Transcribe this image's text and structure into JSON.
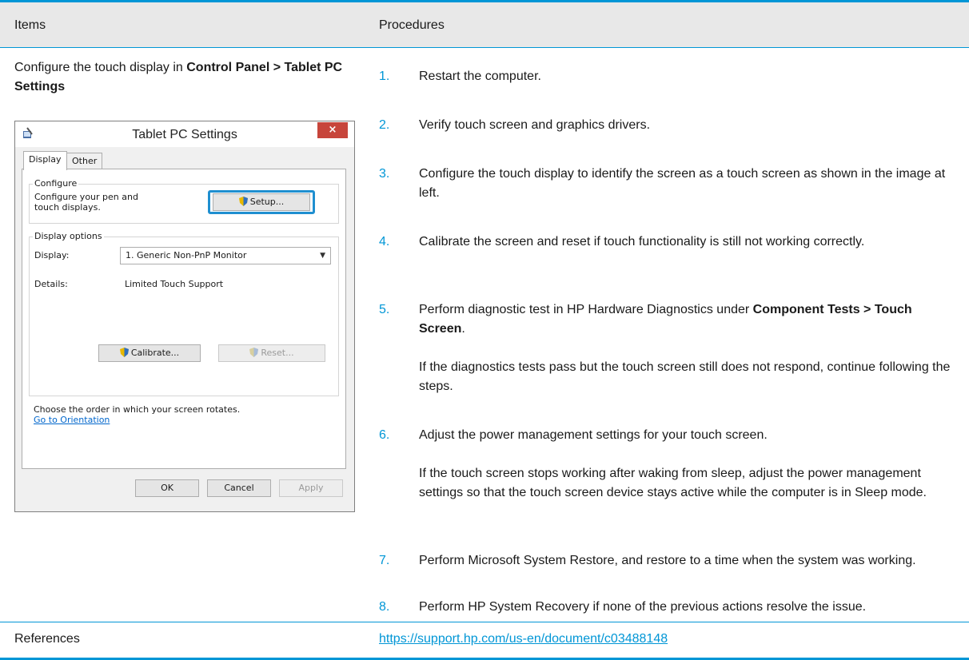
{
  "table": {
    "header_items": "Items",
    "header_procedures": "Procedures",
    "items_text_prefix": "Configure the touch display in ",
    "items_text_bold": "Control Panel > Tablet PC Settings",
    "references_label": "References",
    "references_link": "https://support.hp.com/us-en/document/c03488148"
  },
  "dialog": {
    "title": "Tablet PC Settings",
    "close_glyph": "×",
    "tabs": [
      "Display",
      "Other"
    ],
    "configure_group": "Configure",
    "configure_text": "Configure your pen and touch displays.",
    "setup_button": "Setup...",
    "display_options_group": "Display options",
    "display_label": "Display:",
    "display_value": "1. Generic Non-PnP Monitor",
    "details_label": "Details:",
    "details_value": "Limited Touch Support",
    "calibrate_button": "Calibrate...",
    "reset_button": "Reset...",
    "orientation_text": "Choose the order in which your screen rotates.",
    "orientation_link": "Go to Orientation",
    "ok_button": "OK",
    "cancel_button": "Cancel",
    "apply_button": "Apply"
  },
  "procedures": {
    "s1": {
      "num": "1.",
      "text": "Restart the computer."
    },
    "s2": {
      "num": "2.",
      "text": "Verify touch screen and graphics drivers."
    },
    "s3": {
      "num": "3.",
      "text": "Configure the touch display to identify the screen as a touch screen as shown in the image at left."
    },
    "s4": {
      "num": "4.",
      "text": "Calibrate the screen and reset if touch functionality is still not working correctly."
    },
    "s5": {
      "num": "5.",
      "text_prefix": "Perform diagnostic test in HP Hardware Diagnostics under ",
      "text_bold": "Component Tests > Touch Screen",
      "text_suffix": "."
    },
    "s5_note": "If the diagnostics tests pass but the touch screen still does not respond, continue following the steps.",
    "s6": {
      "num": "6.",
      "text": "Adjust the power management settings for your touch screen."
    },
    "s6_note": "If the touch screen stops working after waking from sleep, adjust the power management settings so that the touch screen device stays active while the computer is in Sleep mode.",
    "s7": {
      "num": "7.",
      "text": "Perform Microsoft System Restore, and restore to a time when the system was working."
    },
    "s8": {
      "num": "8.",
      "text": "Perform HP System Recovery if none of the previous actions resolve the issue."
    }
  }
}
